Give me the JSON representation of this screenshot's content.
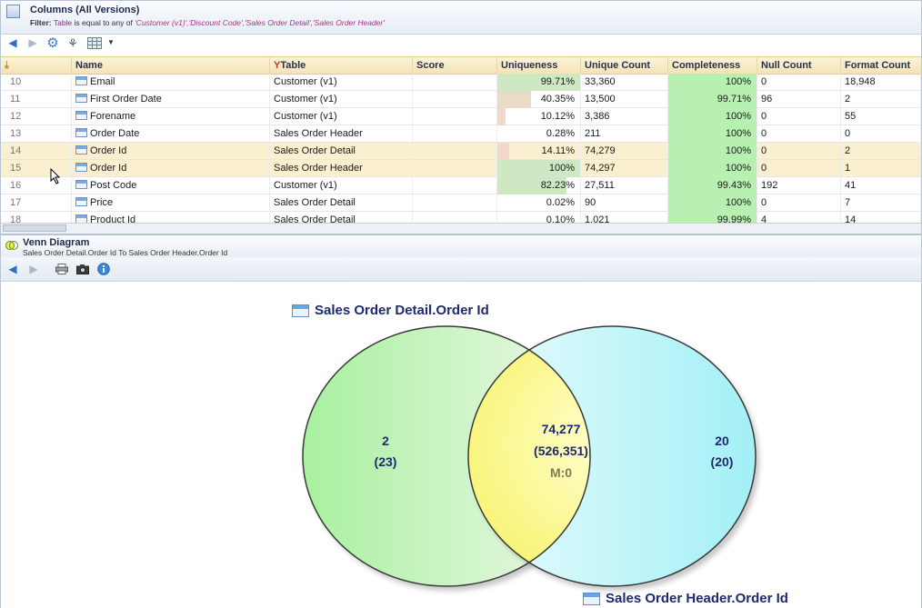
{
  "columns_panel": {
    "title": "Columns (All Versions)",
    "filter_label": "Filter:",
    "filter_field": "Table",
    "filter_text": "is equal to any of",
    "filter_values": "'Customer (v1)','Discount Code','Sales Order Detail','Sales Order Header'",
    "headers": [
      "Name",
      "Table",
      "Score",
      "Uniqueness",
      "Unique Count",
      "Completeness",
      "Null Count",
      "Format Count"
    ],
    "rows": [
      {
        "num": "10",
        "name": "Email",
        "table": "Customer (v1)",
        "score": "",
        "uniqueness": "99.71%",
        "uniqueness_value": 0.9971,
        "unique_count": "33,360",
        "completeness": "100%",
        "null_count": "0",
        "format_count": "18,948",
        "selected": false
      },
      {
        "num": "11",
        "name": "First Order Date",
        "table": "Customer (v1)",
        "score": "",
        "uniqueness": "40.35%",
        "uniqueness_value": 0.4035,
        "unique_count": "13,500",
        "completeness": "99.71%",
        "null_count": "96",
        "format_count": "2",
        "selected": false
      },
      {
        "num": "12",
        "name": "Forename",
        "table": "Customer (v1)",
        "score": "",
        "uniqueness": "10.12%",
        "uniqueness_value": 0.1012,
        "unique_count": "3,386",
        "completeness": "100%",
        "null_count": "0",
        "format_count": "55",
        "selected": false
      },
      {
        "num": "13",
        "name": "Order Date",
        "table": "Sales Order Header",
        "score": "",
        "uniqueness": "0.28%",
        "uniqueness_value": 0.0028,
        "unique_count": "211",
        "completeness": "100%",
        "null_count": "0",
        "format_count": "0",
        "selected": false
      },
      {
        "num": "14",
        "name": "Order Id",
        "table": "Sales Order Detail",
        "score": "",
        "uniqueness": "14.11%",
        "uniqueness_value": 0.1411,
        "unique_count": "74,279",
        "completeness": "100%",
        "null_count": "0",
        "format_count": "2",
        "selected": true
      },
      {
        "num": "15",
        "name": "Order Id",
        "table": "Sales Order Header",
        "score": "",
        "uniqueness": "100%",
        "uniqueness_value": 1.0,
        "unique_count": "74,297",
        "completeness": "100%",
        "null_count": "0",
        "format_count": "1",
        "selected": true
      },
      {
        "num": "16",
        "name": "Post Code",
        "table": "Customer (v1)",
        "score": "",
        "uniqueness": "82.23%",
        "uniqueness_value": 0.8223,
        "unique_count": "27,511",
        "completeness": "99.43%",
        "null_count": "192",
        "format_count": "41",
        "selected": false
      },
      {
        "num": "17",
        "name": "Price",
        "table": "Sales Order Detail",
        "score": "",
        "uniqueness": "0.02%",
        "uniqueness_value": 0.0002,
        "unique_count": "90",
        "completeness": "100%",
        "null_count": "0",
        "format_count": "7",
        "selected": false
      },
      {
        "num": "18",
        "name": "Product Id",
        "table": "Sales Order Detail",
        "score": "",
        "uniqueness": "0.10%",
        "uniqueness_value": 0.001,
        "unique_count": "1,021",
        "completeness": "99.99%",
        "null_count": "4",
        "format_count": "14",
        "selected": false
      }
    ]
  },
  "venn_panel": {
    "title": "Venn Diagram",
    "subtitle": "Sales Order Detail.Order Id To Sales Order Header.Order Id",
    "left_title": "Sales Order Detail.Order Id",
    "right_title": "Sales Order Header.Order Id",
    "left_only": {
      "count": "2",
      "total": "(23)"
    },
    "overlap": {
      "count": "74,277",
      "total": "(526,351)",
      "match": "M:0"
    },
    "right_only": {
      "count": "20",
      "total": "(20)"
    }
  },
  "colors": {
    "title_blue": "#1e2a6e",
    "left_circle": "#a8f0a0",
    "right_circle": "#a6f2f6",
    "overlap": "#fbf57a",
    "completeness_green": "#b8f0b2"
  },
  "icons": [
    "columns-icon",
    "back-arrow-icon",
    "forward-arrow-icon",
    "settings-gear-icon",
    "hierarchy-icon",
    "grid-layout-icon",
    "dropdown-arrow-icon",
    "filter-icon",
    "venn-icon",
    "print-icon",
    "camera-icon",
    "info-icon",
    "mouse-cursor-icon"
  ]
}
